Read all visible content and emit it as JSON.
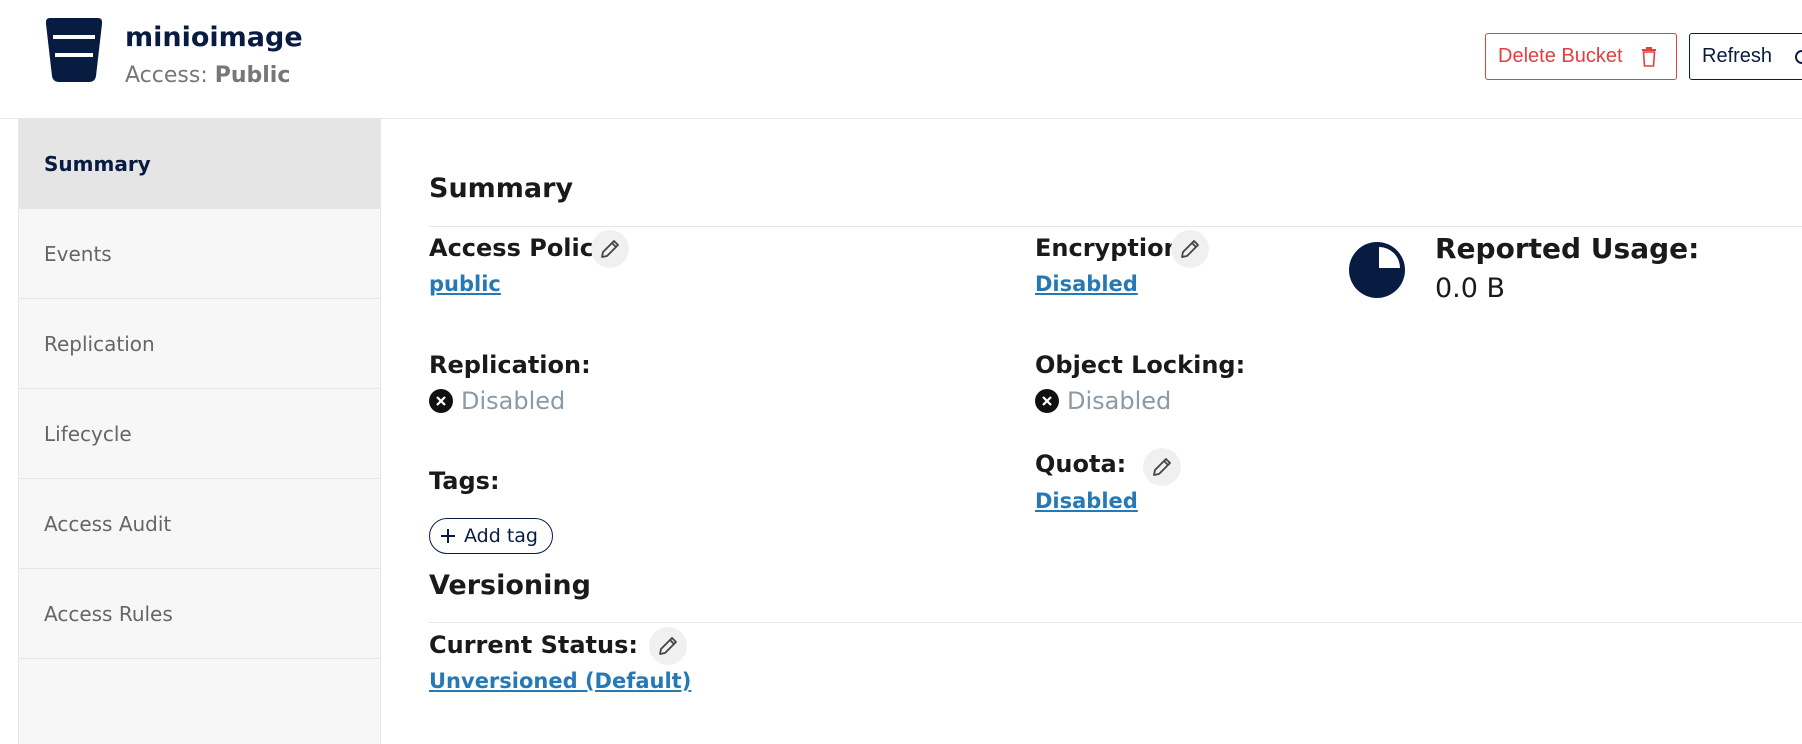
{
  "header": {
    "bucket_name": "minioimage",
    "access_label": "Access:",
    "access_value": "Public",
    "delete_label": "Delete Bucket",
    "refresh_label": "Refresh",
    "accent": "#081c42",
    "danger": "#e53e3e"
  },
  "sidebar": {
    "items": [
      {
        "label": "Summary",
        "active": true
      },
      {
        "label": "Events"
      },
      {
        "label": "Replication"
      },
      {
        "label": "Lifecycle"
      },
      {
        "label": "Access Audit"
      },
      {
        "label": "Access Rules"
      }
    ]
  },
  "summary": {
    "title": "Summary",
    "access_policy": {
      "label": "Access Policy:",
      "value": "public"
    },
    "encryption": {
      "label": "Encryption:",
      "value": "Disabled"
    },
    "replication": {
      "label": "Replication:",
      "value": "Disabled"
    },
    "object_locking": {
      "label": "Object Locking:",
      "value": "Disabled"
    },
    "tags": {
      "label": "Tags:",
      "add_label": "Add tag"
    },
    "quota": {
      "label": "Quota:",
      "value": "Disabled"
    },
    "usage": {
      "label": "Reported Usage:",
      "value": "0.0 B",
      "icon": "pie-chart-icon"
    }
  },
  "versioning": {
    "title": "Versioning",
    "status_label": "Current Status:",
    "status_value": "Unversioned (Default)"
  },
  "icons": {
    "edit": "pencil-icon",
    "disabled": "x-circle-icon",
    "delete": "trash-icon",
    "refresh": "refresh-icon",
    "add": "plus-icon",
    "logo": "bucket-icon"
  }
}
